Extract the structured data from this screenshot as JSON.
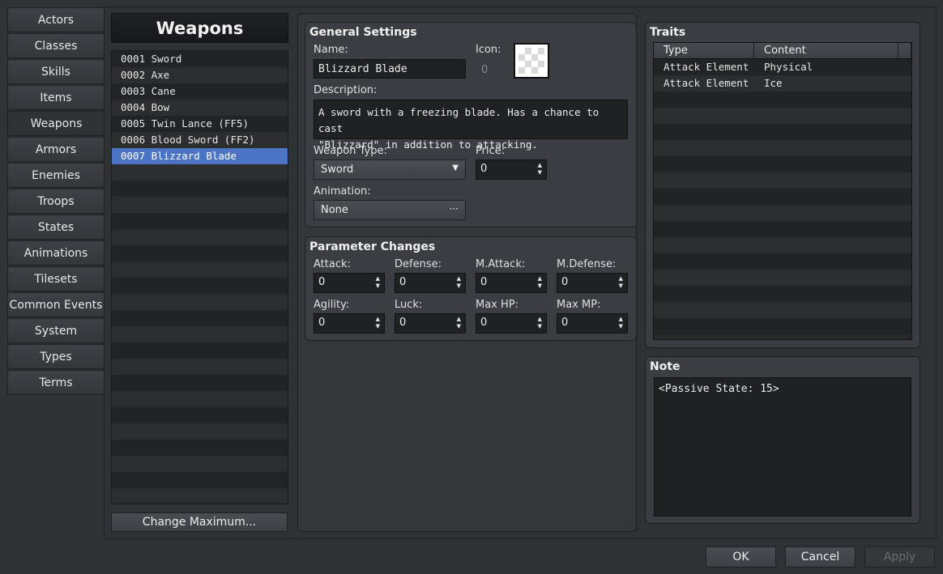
{
  "tabs": [
    "Actors",
    "Classes",
    "Skills",
    "Items",
    "Weapons",
    "Armors",
    "Enemies",
    "Troops",
    "States",
    "Animations",
    "Tilesets",
    "Common Events",
    "System",
    "Types",
    "Terms"
  ],
  "active_tab": "Weapons",
  "list": {
    "title": "Weapons",
    "items": [
      "0001 Sword",
      "0002 Axe",
      "0003 Cane",
      "0004 Bow",
      "0005 Twin Lance (FF5)",
      "0006 Blood Sword (FF2)",
      "0007 Blizzard Blade"
    ],
    "selected_index": 6,
    "change_max_label": "Change Maximum..."
  },
  "general": {
    "title": "General Settings",
    "name_label": "Name:",
    "name_value": "Blizzard Blade",
    "icon_label": "Icon:",
    "icon_index": "0",
    "description_label": "Description:",
    "description_line1": "A sword with a freezing blade. Has a chance to cast",
    "description_line2": "\"Blizzard\" in addition to attacking.",
    "weapon_type_label": "Weapon Type:",
    "weapon_type_value": "Sword",
    "price_label": "Price:",
    "price_value": "0",
    "animation_label": "Animation:",
    "animation_value": "None",
    "animation_button": "···"
  },
  "params": {
    "title": "Parameter Changes",
    "items": [
      {
        "label": "Attack:",
        "value": "0"
      },
      {
        "label": "Defense:",
        "value": "0"
      },
      {
        "label": "M.Attack:",
        "value": "0"
      },
      {
        "label": "M.Defense:",
        "value": "0"
      },
      {
        "label": "Agility:",
        "value": "0"
      },
      {
        "label": "Luck:",
        "value": "0"
      },
      {
        "label": "Max HP:",
        "value": "0"
      },
      {
        "label": "Max MP:",
        "value": "0"
      }
    ]
  },
  "traits": {
    "title": "Traits",
    "col_type": "Type",
    "col_content": "Content",
    "rows": [
      {
        "type": "Attack Element",
        "content": "Physical"
      },
      {
        "type": "Attack Element",
        "content": "Ice"
      }
    ]
  },
  "note": {
    "title": "Note",
    "value": "<Passive State: 15>"
  },
  "dialog": {
    "ok": "OK",
    "cancel": "Cancel",
    "apply": "Apply"
  },
  "colors": {
    "selection": "#4c74c4",
    "background": "#2f3235"
  },
  "icons": {
    "dropdown": "chevron-down-icon",
    "spin": "spin-arrows-icon",
    "ellipsis": "ellipsis-icon"
  }
}
